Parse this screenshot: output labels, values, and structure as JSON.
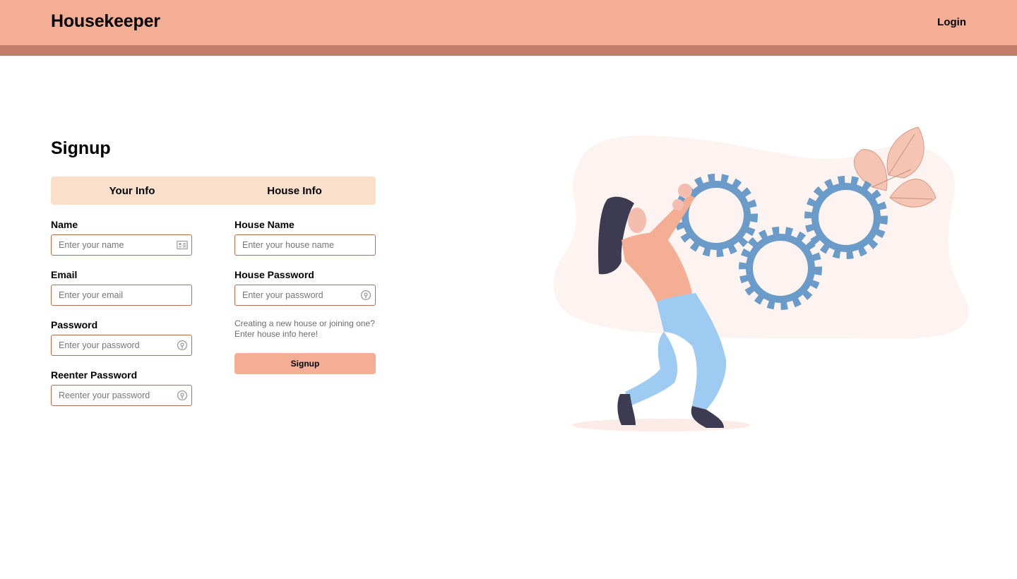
{
  "app": {
    "brand": "Housekeeper"
  },
  "nav": {
    "login_label": "Login"
  },
  "page": {
    "title": "Signup"
  },
  "tabs": [
    {
      "label": "Your Info"
    },
    {
      "label": "House Info"
    }
  ],
  "your_info": {
    "name": {
      "label": "Name",
      "placeholder": "Enter your name",
      "value": ""
    },
    "email": {
      "label": "Email",
      "placeholder": "Enter your email",
      "value": ""
    },
    "password": {
      "label": "Password",
      "placeholder": "Enter your password",
      "value": ""
    },
    "reenter_password": {
      "label": "Reenter Password",
      "placeholder": "Reenter your password",
      "value": ""
    }
  },
  "house_info": {
    "house_name": {
      "label": "House Name",
      "placeholder": "Enter your house name",
      "value": ""
    },
    "house_password": {
      "label": "House Password",
      "placeholder": "Enter your password",
      "value": ""
    },
    "hint_line1": "Creating a new house or joining one?",
    "hint_line2": "Enter house info here!"
  },
  "actions": {
    "signup_label": "Signup"
  },
  "icons": {
    "name_field": "id-card-icon",
    "password_field": "password-key-icon"
  },
  "colors": {
    "navbar": "#f4ae94",
    "navbar_strip": "#c17f6b",
    "tab_bg": "#fae0cb",
    "input_border": "#b86c52",
    "button": "#f4ae94",
    "gear": "#6b9bc8"
  }
}
